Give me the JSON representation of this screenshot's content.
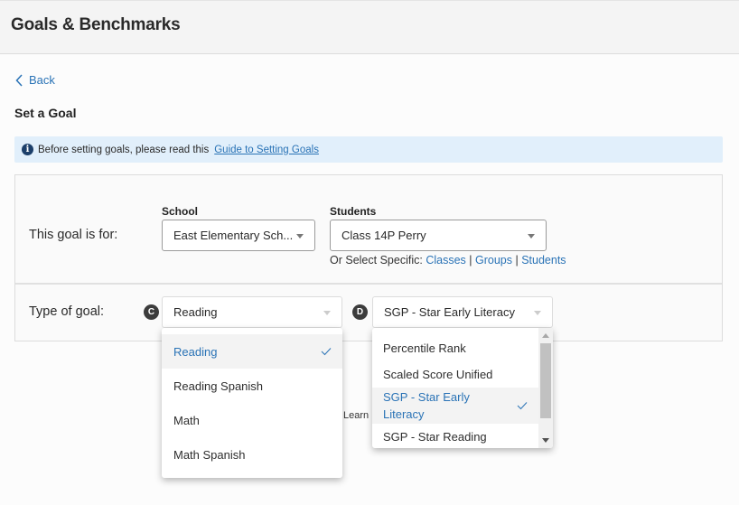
{
  "header": {
    "title": "Goals & Benchmarks"
  },
  "nav": {
    "back_label": "Back"
  },
  "section_title": "Set a Goal",
  "info_banner": {
    "icon": "info-icon",
    "text": "Before setting goals, please read this",
    "link_label": "Guide to Setting Goals"
  },
  "goal_for": {
    "label": "This goal is for:",
    "school": {
      "label": "School",
      "value": "East Elementary Sch..."
    },
    "students": {
      "label": "Students",
      "value": "Class 14P Perry"
    },
    "specific": {
      "prefix": "Or Select Specific:",
      "links": [
        "Classes",
        "Groups",
        "Students"
      ],
      "separator": "|"
    }
  },
  "goal_type": {
    "label": "Type of goal:",
    "subject_badge": "C",
    "subject_value": "Reading",
    "metric_badge": "D",
    "metric_value": "SGP - Star Early Literacy"
  },
  "subject_dropdown": {
    "options": [
      {
        "label": "Reading",
        "selected": true
      },
      {
        "label": "Reading Spanish",
        "selected": false
      },
      {
        "label": "Math",
        "selected": false
      },
      {
        "label": "Math Spanish",
        "selected": false
      }
    ]
  },
  "metric_dropdown": {
    "options": [
      {
        "label": "Percentile Rank",
        "selected": false
      },
      {
        "label": "Scaled Score Unified",
        "selected": false
      },
      {
        "label": "SGP - Star Early Literacy",
        "selected": true
      },
      {
        "label": "SGP - Star Reading",
        "selected": false
      }
    ]
  },
  "background_text": "Learn",
  "colors": {
    "link": "#2a73b6",
    "banner_bg": "#e1effb",
    "header_bg": "#f4f4f4",
    "badge_bg": "#3c3c3c",
    "selected_bg": "#f3f3f3"
  }
}
